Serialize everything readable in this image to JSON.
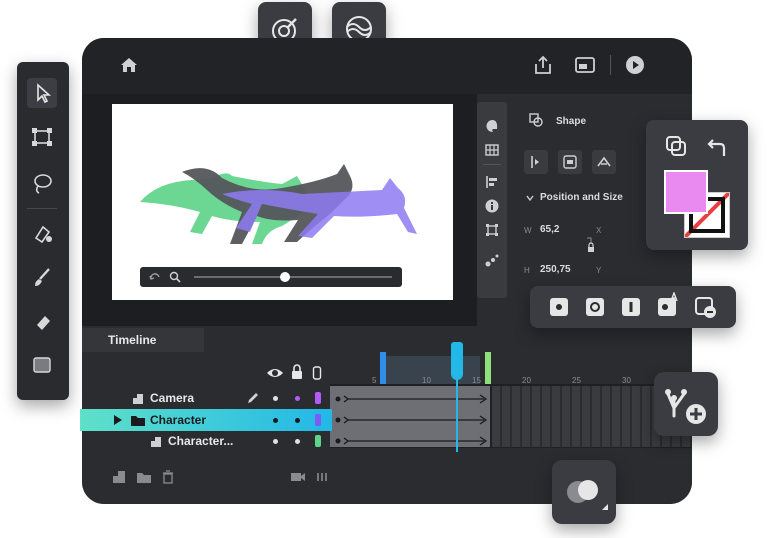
{
  "properties": {
    "shape_label": "Shape",
    "position_size_label": "Position and Size",
    "w_label": "W",
    "w_value": "65,2",
    "h_label": "H",
    "h_value": "250,75",
    "x_label": "X",
    "y_label": "Y"
  },
  "timeline": {
    "title": "Timeline",
    "ticks": [
      "5",
      "10",
      "15",
      "20",
      "25",
      "30"
    ],
    "layers": [
      {
        "name": "Camera"
      },
      {
        "name": "Character"
      },
      {
        "name": "Character..."
      }
    ]
  },
  "colors": {
    "accent": "#22b8e8",
    "selected_row": "#5fd5c8",
    "fill_swatch": "#e98af0",
    "shape_green": "#5fd38a",
    "shape_purple": "#8e7bf2",
    "shape_gray": "#55565b"
  }
}
